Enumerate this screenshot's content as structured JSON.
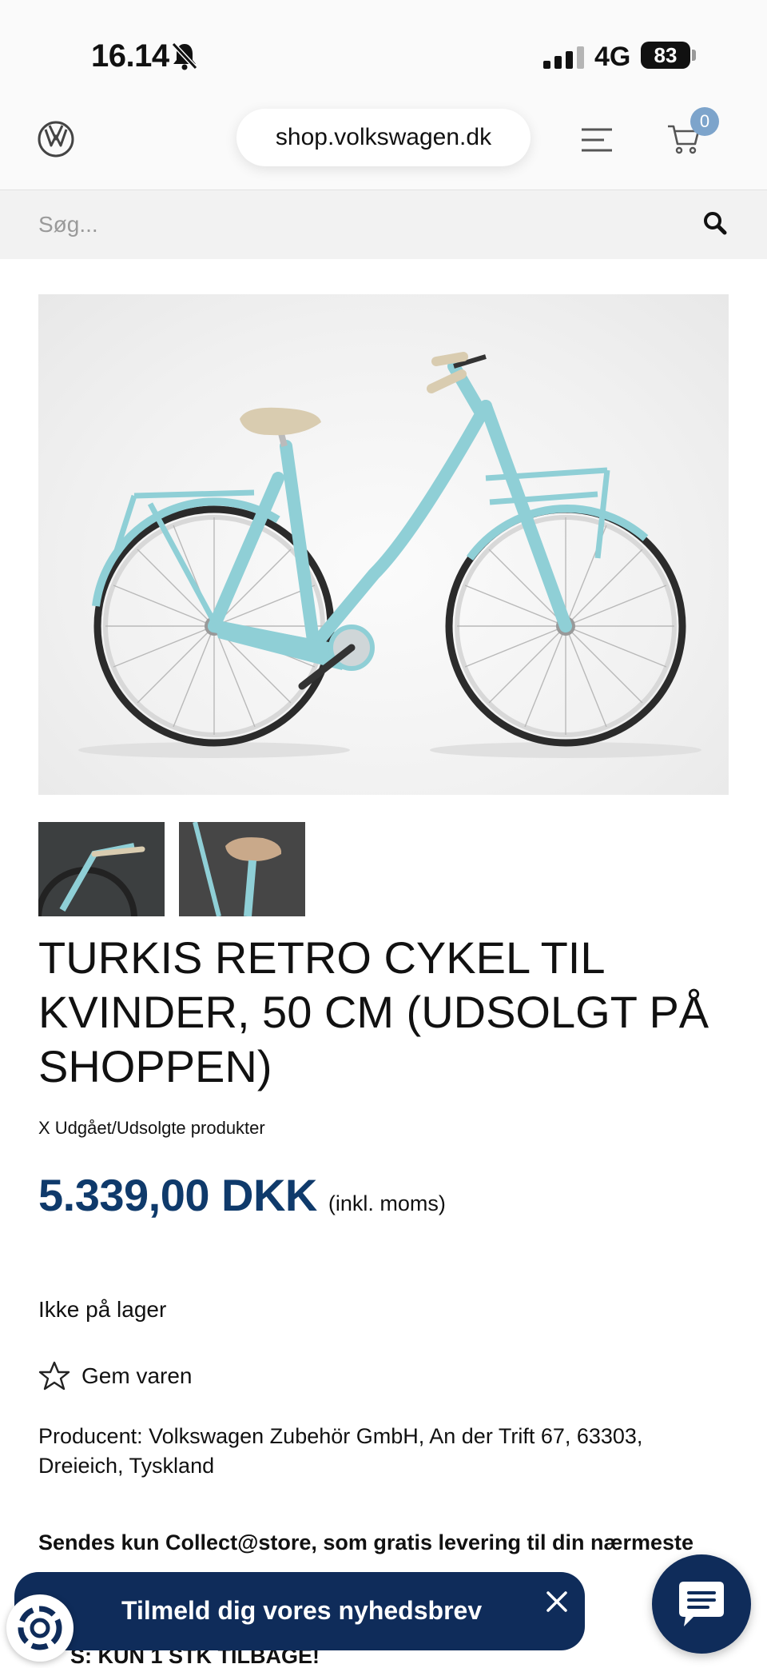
{
  "status_bar": {
    "time": "16.14",
    "network": "4G",
    "battery": "83"
  },
  "header": {
    "url": "shop.volkswagen.dk",
    "cart_count": "0"
  },
  "search": {
    "placeholder": "Søg..."
  },
  "product": {
    "title": "TURKIS RETRO CYKEL TIL KVINDER, 50 CM (UDSOLGT PÅ SHOPPEN)",
    "status_line": "X Udgået/Udsolgte produkter",
    "price": "5.339,00 DKK",
    "vat_note": "(inkl. moms)",
    "stock": "Ikke på lager",
    "wishlist_label": "Gem varen",
    "manufacturer": "Producent: Volkswagen Zubehör GmbH, An der Trift 67, 63303, Dreieich, Tyskland",
    "shipping_note": "Sendes kun Collect@store, som gratis levering til din nærmeste",
    "stock_warning": "S: KUN 1 STK TILBAGE!"
  },
  "newsletter": {
    "label": "Tilmeld dig vores nyhedsbrev"
  },
  "colors": {
    "price": "#0f3a6b",
    "newsletter_bg": "#0f2c5a",
    "bike_frame": "#8fcfd6",
    "cart_badge": "#7da4cb"
  },
  "icons": [
    "bell-off-icon",
    "signal-icon",
    "battery-icon",
    "vw-logo",
    "menu-icon",
    "cart-icon",
    "search-icon",
    "star-icon",
    "close-icon",
    "chat-icon",
    "trusted-badge-icon"
  ]
}
